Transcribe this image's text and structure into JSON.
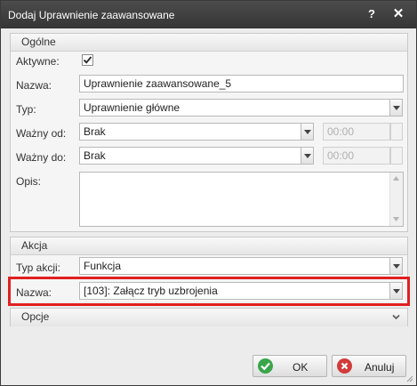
{
  "window": {
    "title": "Dodaj Uprawnienie zaawansowane",
    "help_glyph": "?",
    "close_glyph": "✕"
  },
  "general": {
    "header": "Ogólne",
    "active_label": "Aktywne:",
    "active_checked": true,
    "name_label": "Nazwa:",
    "name_value": "Uprawnienie zaawansowane_5",
    "type_label": "Typ:",
    "type_value": "Uprawnienie główne",
    "valid_from_label": "Ważny od:",
    "valid_from_value": "Brak",
    "valid_from_time": "00:00",
    "valid_to_label": "Ważny do:",
    "valid_to_value": "Brak",
    "valid_to_time": "00:00",
    "description_label": "Opis:",
    "description_value": ""
  },
  "action": {
    "header": "Akcja",
    "action_type_label": "Typ akcji:",
    "action_type_value": "Funkcja",
    "name_label": "Nazwa:",
    "name_value": "[103]: Załącz tryb uzbrojenia"
  },
  "options": {
    "header": "Opcje"
  },
  "buttons": {
    "ok_label": "OK",
    "cancel_label": "Anuluj"
  },
  "colors": {
    "highlight": "#e02020",
    "ok_icon": "#3aa54a",
    "cancel_icon": "#d23b3b",
    "titlebar": "#3f3f3f"
  }
}
